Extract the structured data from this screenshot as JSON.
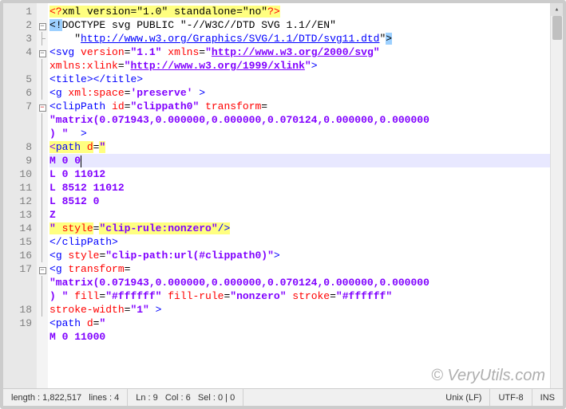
{
  "gutter_lines": [
    "1",
    "2",
    "3",
    "4",
    "",
    "5",
    "6",
    "7",
    "",
    "",
    "8",
    "9",
    "10",
    "11",
    "12",
    "13",
    "14",
    "15",
    "16",
    "17",
    "",
    "",
    "18",
    "19"
  ],
  "fold": [
    "",
    "open",
    "end",
    "open",
    "",
    "",
    "",
    "open-red",
    "",
    "",
    "",
    "",
    "",
    "",
    "",
    "",
    "",
    "",
    "",
    "open",
    "",
    "",
    "",
    ""
  ],
  "code": {
    "l1": {
      "a": "<?",
      "b": "xml ",
      "c": "version",
      "d": "=",
      "e": "\"1.0\"",
      "f": " standalone",
      "g": "=",
      "h": "\"no\"",
      "i": "?>"
    },
    "l2": {
      "a": "<!",
      "b": "DOCTYPE svg PUBLIC \"-//W3C//DTD SVG 1.1//EN\""
    },
    "l3": {
      "a": "    \"",
      "b": "http://www.w3.org/Graphics/SVG/1.1/DTD/svg11.dtd",
      "c": "\"",
      "d": ">"
    },
    "l4": {
      "a": "<",
      "b": "svg ",
      "c": "version",
      "d": "=",
      "e": "\"1.1\"",
      "f": " xmlns",
      "g": "=",
      "h": "\"",
      "i": "http://www.w3.org/2000/svg",
      "j": "\""
    },
    "l4b": {
      "a": "xmlns:xlink",
      "b": "=",
      "c": "\"",
      "d": "http://www.w3.org/1999/xlink",
      "e": "\"",
      "f": ">"
    },
    "l5": {
      "a": "<",
      "b": "title",
      "c": "></",
      "d": "title",
      "e": ">"
    },
    "l6": {
      "a": "<",
      "b": "g ",
      "c": "xml:space",
      "d": "=",
      "e": "'preserve'",
      "f": " >"
    },
    "l7": {
      "a": "<",
      "b": "clipPath ",
      "c": "id",
      "d": "=",
      "e": "\"clippath0\"",
      "f": " transform",
      "g": "="
    },
    "l7b": {
      "a": "\"matrix(0.071943,0.000000,0.000000,0.070124,0.000000,0.000000"
    },
    "l7c": {
      "a": ") \"",
      "b": "  >"
    },
    "l8": {
      "a": "<",
      "b": "path ",
      "c": "d",
      "d": "=",
      "e": "\""
    },
    "l9": {
      "a": "M 0 0"
    },
    "l10": {
      "a": "L 0 11012"
    },
    "l11": {
      "a": "L 8512 11012"
    },
    "l12": {
      "a": "L 8512 0"
    },
    "l13": {
      "a": "Z"
    },
    "l14": {
      "a": "\"",
      "b": " style",
      "c": "=",
      "d": "\"clip-rule:nonzero\"",
      "e": "/>"
    },
    "l15": {
      "a": "</",
      "b": "clipPath",
      "c": ">"
    },
    "l16": {
      "a": "<",
      "b": "g ",
      "c": "style",
      "d": "=",
      "e": "\"clip-path:url(#clippath0)\"",
      "f": ">"
    },
    "l17": {
      "a": "<",
      "b": "g ",
      "c": "transform",
      "d": "="
    },
    "l17b": {
      "a": "\"matrix(0.071943,0.000000,0.000000,0.070124,0.000000,0.000000"
    },
    "l17c": {
      "a": ") \"",
      "b": " fill",
      "c": "=",
      "d": "\"#ffffff\"",
      "e": " fill-rule",
      "f": "=",
      "g": "\"nonzero\"",
      "h": " stroke",
      "i": "=",
      "j": "\"#ffffff\""
    },
    "l17d": {
      "a": "stroke-width",
      "b": "=",
      "c": "\"1\"",
      "d": " >"
    },
    "l18": {
      "a": "<",
      "b": "path ",
      "c": "d",
      "d": "=",
      "e": "\""
    },
    "l19": {
      "a": "M 0 11000"
    }
  },
  "status": {
    "length_label": "length :",
    "length_value": "1,822,517",
    "lines_label": "lines :",
    "lines_value": "4",
    "ln_label": "Ln :",
    "ln_value": "9",
    "col_label": "Col :",
    "col_value": "6",
    "sel_label": "Sel :",
    "sel_value": "0 | 0",
    "eol": "Unix (LF)",
    "encoding": "UTF-8",
    "mode": "INS"
  },
  "watermark": "© VeryUtils.com"
}
